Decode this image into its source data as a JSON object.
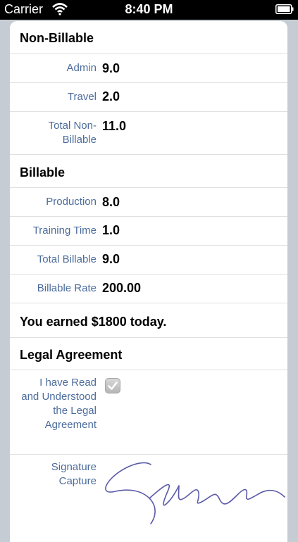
{
  "status": {
    "carrier": "Carrier",
    "time": "8:40 PM"
  },
  "non_billable": {
    "title": "Non-Billable",
    "rows": [
      {
        "label": "Admin",
        "value": "9.0"
      },
      {
        "label": "Travel",
        "value": "2.0"
      },
      {
        "label": "Total Non-Billable",
        "value": "11.0"
      }
    ]
  },
  "billable": {
    "title": "Billable",
    "rows": [
      {
        "label": "Production",
        "value": "8.0"
      },
      {
        "label": "Training Time",
        "value": "1.0"
      },
      {
        "label": "Total Billable",
        "value": "9.0"
      },
      {
        "label": "Billable Rate",
        "value": "200.00"
      }
    ]
  },
  "earned_text": "You earned $1800 today.",
  "legal": {
    "title": "Legal Agreement",
    "agreement_label": "I have Read and Understood the Legal Agreement",
    "agreement_checked": true,
    "signature_label": "Signature Capture",
    "signature_color": "#5b5ba8"
  }
}
